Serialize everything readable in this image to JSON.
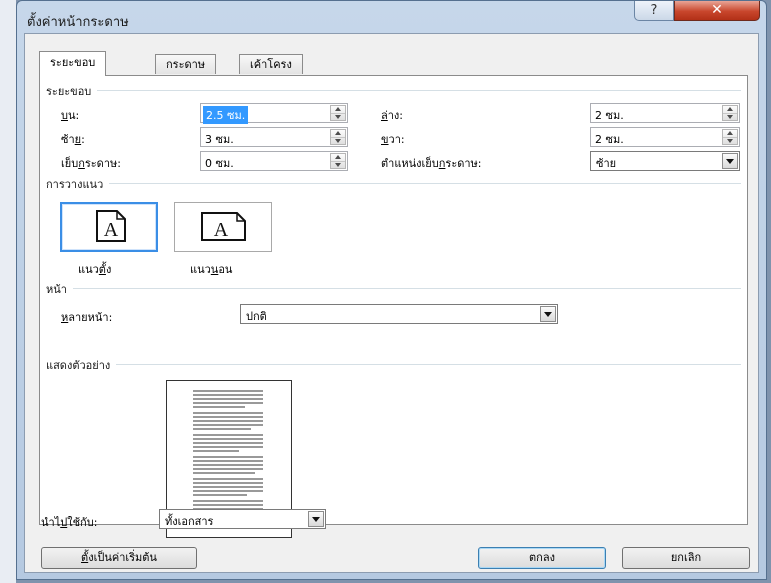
{
  "window": {
    "title": "ตั้งค่าหน้ากระดาษ",
    "help_glyph": "?",
    "close_glyph": "✕"
  },
  "tabs": [
    {
      "label": "ระยะขอบ",
      "active": true
    },
    {
      "label": "กระดาษ",
      "active": false
    },
    {
      "label": "เค้าโครง",
      "active": false
    }
  ],
  "margins": {
    "section_label": "ระยะขอบ",
    "top": {
      "pre": "",
      "key": "บ",
      "post": "น:",
      "value": "2.5 ซม."
    },
    "bottom": {
      "pre": "",
      "key": "ล",
      "post": "่าง:",
      "value": "2 ซม."
    },
    "left": {
      "pre": "ซ้า",
      "key": "ย",
      "post": ":",
      "value": "3 ซม."
    },
    "right": {
      "pre": "",
      "key": "ข",
      "post": "วา:",
      "value": "2 ซม."
    },
    "gutter": {
      "pre": "เย็บ",
      "key": "ก",
      "post": "ระดาษ:",
      "value": "0 ซม."
    },
    "gutter_position": {
      "pre": "ตำแหน่งเย็บ",
      "key": "ก",
      "post": "ระดาษ:",
      "value": "ซ้าย"
    }
  },
  "orientation": {
    "section_label": "การวางแนว",
    "portrait": {
      "pre": "แนว",
      "key": "ต",
      "post": "ั้ง",
      "icon_letter": "A",
      "selected": true
    },
    "landscape": {
      "pre": "แนว",
      "key": "น",
      "post": "อน",
      "icon_letter": "A",
      "selected": false
    }
  },
  "pages": {
    "section_label": "หน้า",
    "multiple_label": {
      "pre": "",
      "key": "ห",
      "post": "ลายหน้า:"
    },
    "multiple_value": "ปกติ"
  },
  "preview": {
    "section_label": "แสดงตัวอย่าง"
  },
  "apply_to": {
    "label": {
      "pre": "นำไ",
      "key": "ป",
      "post": "ใช้กับ:"
    },
    "value": "ทั้งเอกสาร"
  },
  "buttons": {
    "set_default": {
      "pre": "",
      "key": "ตั้",
      "post": "งเป็นค่าเริ่มต้น"
    },
    "ok": "ตกลง",
    "cancel": "ยกเลิก"
  },
  "colors": {
    "selection": "#3399ff",
    "close_button": "#c8462c",
    "frame": "#b5c9e1"
  }
}
